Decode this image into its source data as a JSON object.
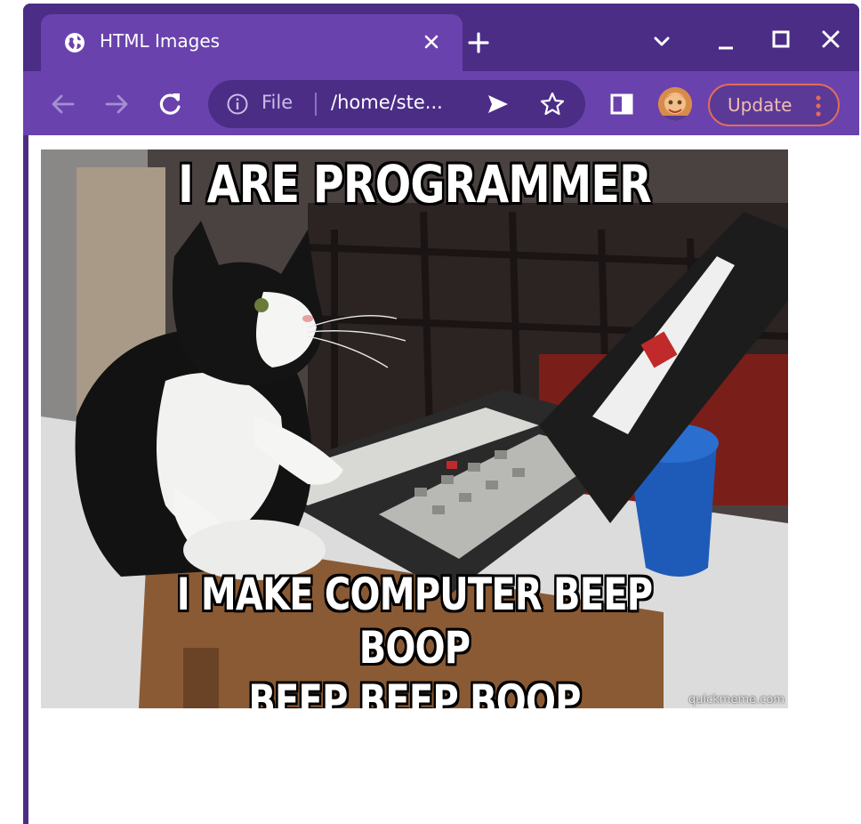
{
  "tab": {
    "title": "HTML Images",
    "close_icon": "close-icon",
    "favicon": "globe-icon"
  },
  "window_controls": [
    "chevron-down-icon",
    "minimize-icon",
    "maximize-icon",
    "close-icon"
  ],
  "toolbar": {
    "back_icon": "arrow-left-icon",
    "forward_icon": "arrow-right-icon",
    "reload_icon": "reload-icon",
    "omnibox": {
      "scheme_label": "File",
      "path": "/home/ste..."
    },
    "update_label": "Update"
  },
  "content": {
    "image": {
      "top_text": "I ARE PROGRAMMER",
      "bottom_text_line1": "I MAKE COMPUTER BEEP BOOP",
      "bottom_text_line2": "BEEP BEEP BOOP",
      "watermark": "quickmeme.com"
    }
  },
  "colors": {
    "frame": "#4b2d86",
    "toolbar": "#6a42ad",
    "update_border": "#e46b5a"
  }
}
